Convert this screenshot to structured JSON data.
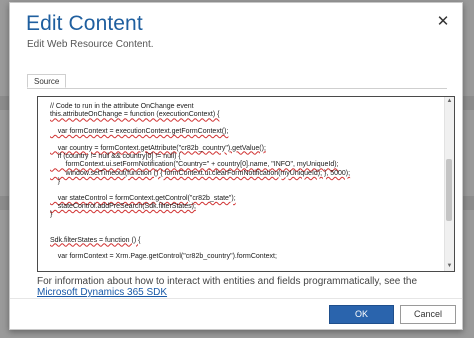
{
  "dialog": {
    "title": "Edit Content",
    "subtitle": "Edit Web Resource Content.",
    "close_symbol": "✕"
  },
  "tabs": [
    {
      "label": "Source",
      "active": true
    }
  ],
  "code_lines": [
    "// Code to run in the attribute OnChange event",
    "this.attributeOnChange = function (executionContext) {",
    "",
    "    var formContext = executionContext.getFormContext();",
    "",
    "    var country = formContext.getAttribute(\"cr82b_country\").getValue();",
    "    if (country != null && country[0] != null) {",
    "        formContext.ui.setFormNotification(\"Country=\" + country[0].name, \"INFO\", myUniqueId);",
    "        window.setTimeout(function () { formContext.ui.clearFormNotification(myUniqueId); }, 5000);",
    "    }",
    "",
    "    var stateControl = formContext.getControl(\"cr82b_state\");",
    "    stateControl.addPreSearch(Sdk.filterStates);",
    "}",
    "",
    "",
    "Sdk.filterStates = function () {",
    "",
    "    var formContext = Xrm.Page.getControl(\"cr82b_country\").formContext;"
  ],
  "squiggly_lines": [
    1,
    3,
    5,
    7,
    8,
    11,
    12,
    16
  ],
  "help": {
    "text": "For information about how to interact with entities and fields programmatically, see the ",
    "link_text": "Microsoft Dynamics 365 SDK"
  },
  "buttons": {
    "ok": "OK",
    "cancel": "Cancel"
  },
  "icons": {
    "close": "close-icon",
    "scroll_up": "chevron-up-icon",
    "scroll_down": "chevron-down-icon"
  },
  "colors": {
    "title": "#1f5f9f",
    "primary_button": "#2a64ad",
    "link": "#1a5aa8",
    "squiggle": "#d03030"
  }
}
